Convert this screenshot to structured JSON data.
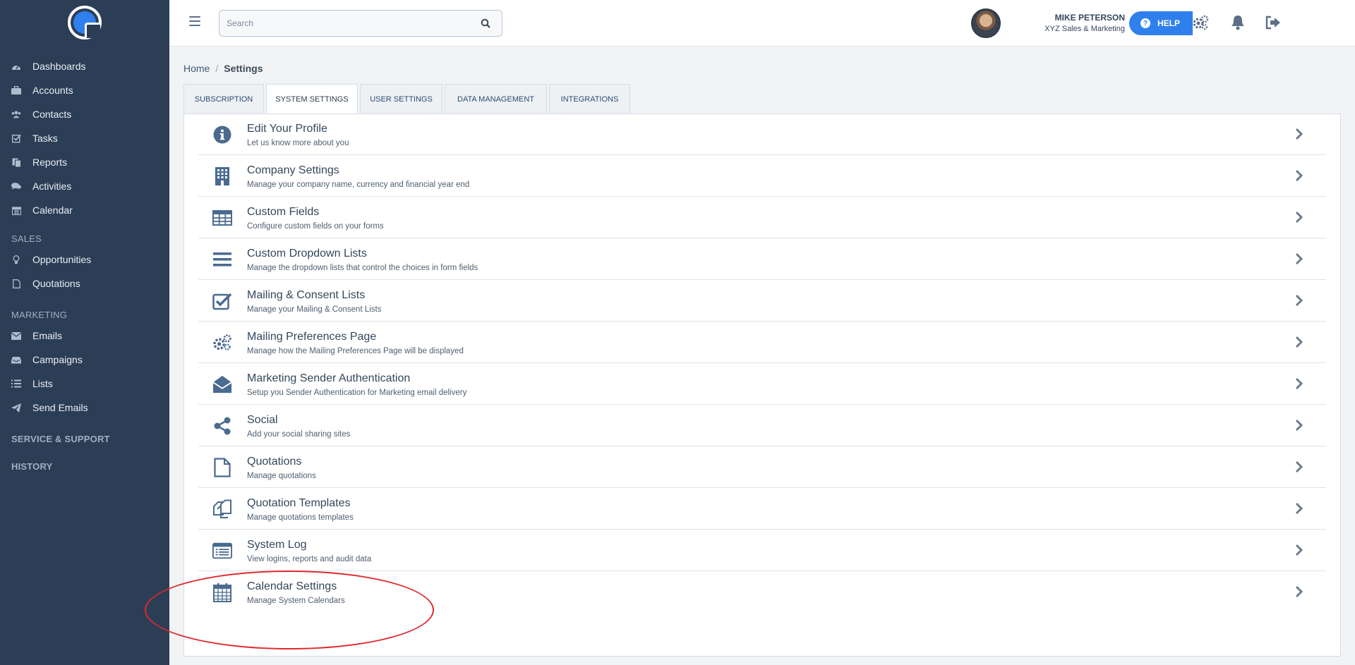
{
  "sidebar": {
    "items": [
      {
        "label": "Dashboards",
        "icon": "dashboard-icon"
      },
      {
        "label": "Accounts",
        "icon": "briefcase-icon"
      },
      {
        "label": "Contacts",
        "icon": "users-icon"
      },
      {
        "label": "Tasks",
        "icon": "checkbox-icon"
      },
      {
        "label": "Reports",
        "icon": "reports-icon"
      },
      {
        "label": "Activities",
        "icon": "comments-icon"
      },
      {
        "label": "Calendar",
        "icon": "calendar-icon"
      }
    ],
    "sales_label": "SALES",
    "sales_items": [
      {
        "label": "Opportunities",
        "icon": "lightbulb-icon"
      },
      {
        "label": "Quotations",
        "icon": "file-icon"
      }
    ],
    "marketing_label": "MARKETING",
    "marketing_items": [
      {
        "label": "Emails",
        "icon": "envelope-icon"
      },
      {
        "label": "Campaigns",
        "icon": "inbox-icon"
      },
      {
        "label": "Lists",
        "icon": "list-icon"
      },
      {
        "label": "Send Emails",
        "icon": "paper-plane-icon"
      }
    ],
    "service_label": "SERVICE & SUPPORT",
    "history_label": "HISTORY"
  },
  "topbar": {
    "search_placeholder": "Search",
    "user_name": "MIKE PETERSON",
    "user_company": "XYZ Sales & Marketing",
    "help_label": "HELP"
  },
  "breadcrumb": {
    "home": "Home",
    "separator": "/",
    "current": "Settings"
  },
  "tabs": [
    {
      "label": "SUBSCRIPTION"
    },
    {
      "label": "SYSTEM SETTINGS",
      "active": true
    },
    {
      "label": "USER SETTINGS"
    },
    {
      "label": "DATA MANAGEMENT"
    },
    {
      "label": "INTEGRATIONS"
    }
  ],
  "settings": [
    {
      "title": "Edit Your Profile",
      "desc": "Let us know more about you",
      "icon": "info-icon"
    },
    {
      "title": "Company Settings",
      "desc": "Manage your company name, currency and financial year end",
      "icon": "building-icon"
    },
    {
      "title": "Custom Fields",
      "desc": "Configure custom fields on your forms",
      "icon": "table-icon"
    },
    {
      "title": "Custom Dropdown Lists",
      "desc": "Manage the dropdown lists that control the choices in form fields",
      "icon": "bars-icon"
    },
    {
      "title": "Mailing & Consent Lists",
      "desc": "Manage your Mailing & Consent Lists",
      "icon": "check-square-icon"
    },
    {
      "title": "Mailing Preferences Page",
      "desc": "Manage how the Mailing Preferences Page will be displayed",
      "icon": "cogs-icon"
    },
    {
      "title": "Marketing Sender Authentication",
      "desc": "Setup you Sender Authentication for Marketing email delivery",
      "icon": "envelope-open-icon"
    },
    {
      "title": "Social",
      "desc": "Add your social sharing sites",
      "icon": "share-icon"
    },
    {
      "title": "Quotations",
      "desc": "Manage quotations",
      "icon": "file-icon"
    },
    {
      "title": "Quotation Templates",
      "desc": "Manage quotations templates",
      "icon": "copy-icon"
    },
    {
      "title": "System Log",
      "desc": "View logins, reports and audit data",
      "icon": "list-alt-icon"
    },
    {
      "title": "Calendar Settings",
      "desc": "Manage System Calendars",
      "icon": "calendar-icon"
    }
  ],
  "colors": {
    "sidebar_bg": "#2c3e55",
    "accent": "#2f80ed",
    "annotation": "#e0282d"
  }
}
